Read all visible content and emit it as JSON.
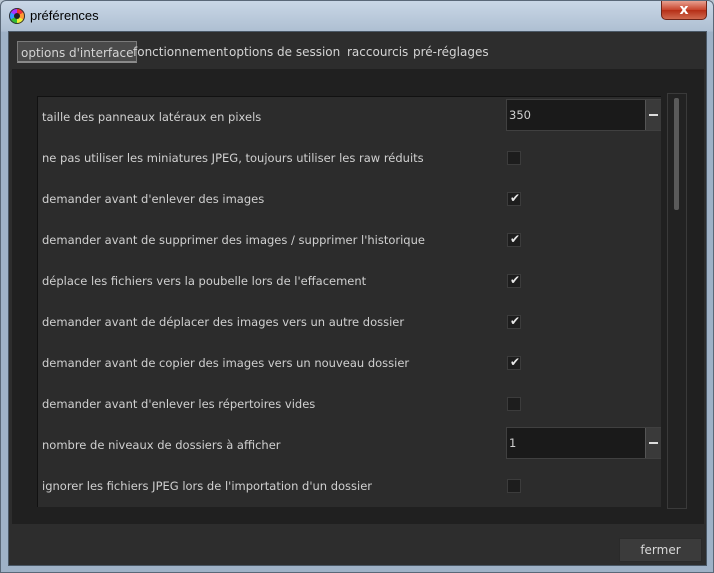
{
  "window": {
    "title": "préférences",
    "close_glyph": "x"
  },
  "tabs": [
    {
      "label": "options d'interface",
      "active": true
    },
    {
      "label": "fonctionnement",
      "active": false
    },
    {
      "label": "options de session",
      "active": false
    },
    {
      "label": "raccourcis",
      "active": false
    },
    {
      "label": "pré-réglages",
      "active": false
    }
  ],
  "settings": [
    {
      "label": "taille des panneaux latéraux en pixels",
      "type": "spin",
      "value": "350"
    },
    {
      "label": "ne pas utiliser les miniatures JPEG, toujours utiliser les raw réduits",
      "type": "checkbox",
      "checked": false
    },
    {
      "label": "demander avant d'enlever des images",
      "type": "checkbox",
      "checked": true
    },
    {
      "label": "demander avant de supprimer des images / supprimer l'historique",
      "type": "checkbox",
      "checked": true
    },
    {
      "label": "déplace les fichiers vers la poubelle lors de l'effacement",
      "type": "checkbox",
      "checked": true
    },
    {
      "label": "demander avant de déplacer des images vers un autre dossier",
      "type": "checkbox",
      "checked": true
    },
    {
      "label": "demander avant de copier des images vers un nouveau dossier",
      "type": "checkbox",
      "checked": true
    },
    {
      "label": "demander avant d'enlever les répertoires vides",
      "type": "checkbox",
      "checked": false
    },
    {
      "label": "nombre de niveaux de dossiers à afficher",
      "type": "spin",
      "value": "1"
    },
    {
      "label": "ignorer les fichiers JPEG lors de l'importation d'un dossier",
      "type": "checkbox",
      "checked": false
    }
  ],
  "icons": {
    "app": "darktable-icon",
    "checkmark": "✔"
  },
  "footer": {
    "close_label": "fermer"
  }
}
